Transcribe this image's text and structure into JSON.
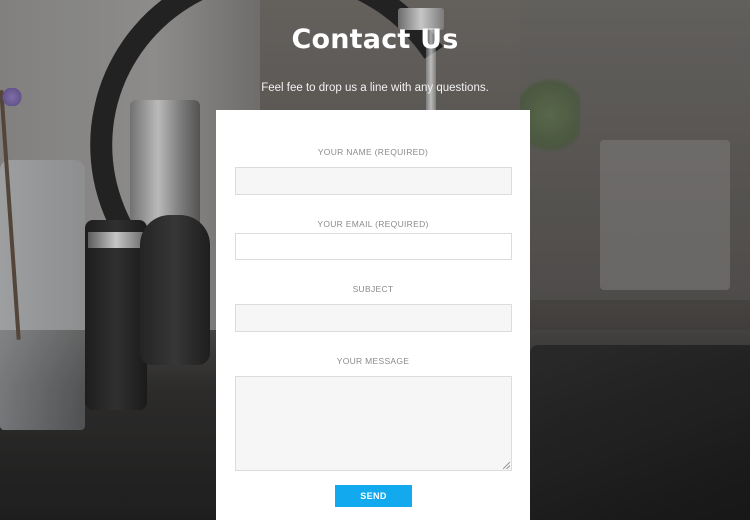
{
  "header": {
    "title": "Contact Us",
    "subtitle": "Feel fee to drop us a line with any questions."
  },
  "form": {
    "name_label": "YOUR NAME (REQUIRED)",
    "name_value": "",
    "email_label": "YOUR EMAIL (REQUIRED)",
    "email_value": "",
    "subject_label": "SUBJECT",
    "subject_value": "",
    "message_label": "YOUR MESSAGE",
    "message_value": "",
    "send_label": "SEND"
  },
  "colors": {
    "accent": "#12a9ee",
    "card_background": "#ffffff",
    "label_text": "#8a8a8a",
    "title_text": "#ffffff"
  }
}
